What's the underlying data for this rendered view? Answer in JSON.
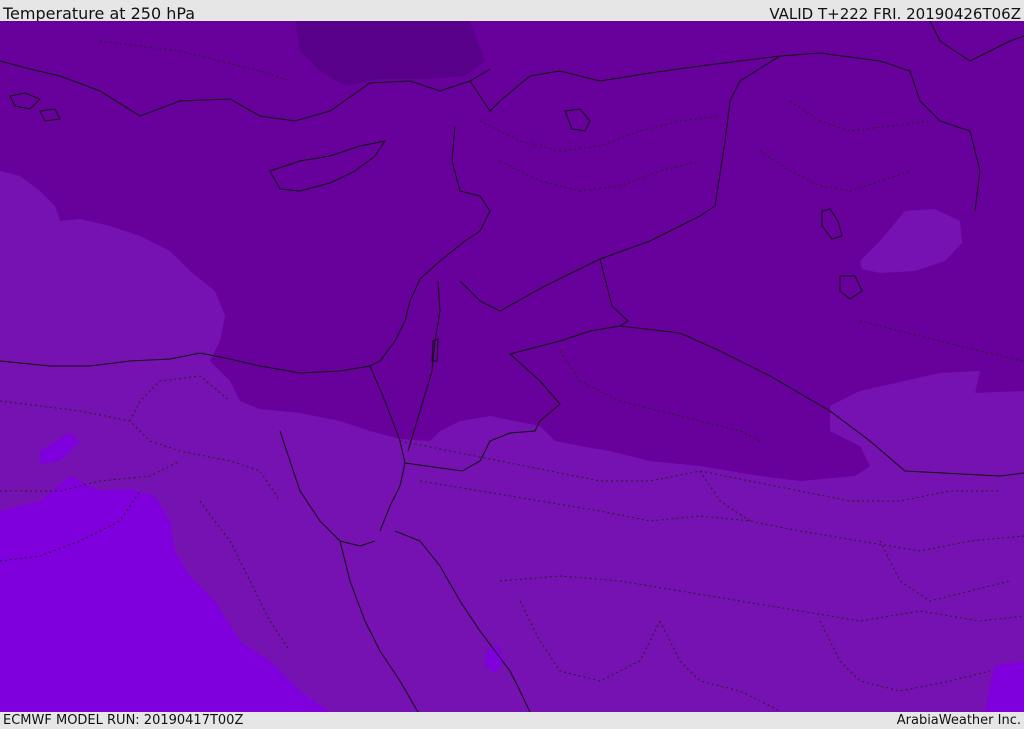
{
  "header": {
    "title": "Temperature at 250 hPa",
    "valid": "VALID T+222 FRI. 20190426T06Z"
  },
  "footer": {
    "model_run": "ECMWF MODEL RUN: 20190417T00Z",
    "credit": "ArabiaWeather Inc."
  },
  "colors": {
    "darkest_band": "#58008a",
    "dark_band": "#68009c",
    "mid_band": "#7512b1",
    "light_band": "#7f00dc",
    "boundaries": "#111111"
  }
}
